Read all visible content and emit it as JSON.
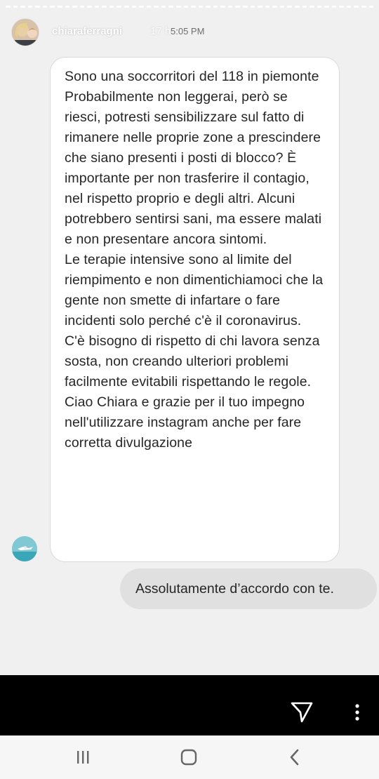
{
  "story": {
    "username": "chiaraferragni",
    "elapsed": "17 h",
    "clock": "5:05 PM"
  },
  "message": {
    "paragraphs": [
      "Sono una soccorritori del 118 in piemonte",
      "Probabilmente non leggerai, però se riesci, potresti sensibilizzare sul fatto di rimanere nelle proprie zone a prescindere che siano presenti i posti di blocco? È importante per non trasferire il contagio, nel rispetto proprio e degli altri. Alcuni potrebbero sentirsi sani, ma essere malati e non presentare ancora sintomi.",
      "Le terapie intensive sono al limite del riempimento e non dimentichiamoci che la gente non smette di infartare o fare incidenti solo perché c'è il coronavirus.",
      "C'è bisogno di rispetto di chi lavora senza sosta, non creando ulteriori problemi facilmente evitabili rispettando le regole.",
      "Ciao Chiara e grazie per il tuo impegno nell'utilizzare instagram anche per fare corretta divulgazione"
    ]
  },
  "reply": {
    "text": "Assolutamente d’accordo con te."
  },
  "icons": {
    "send": "send-icon",
    "more": "more-vertical-icon",
    "recents": "recent-apps-icon",
    "home": "home-icon",
    "back": "back-icon"
  },
  "colors": {
    "story_background": "#f0f0f0",
    "bubble": "#ffffff",
    "reply_bubble": "#e0e0e0",
    "text": "#262626"
  }
}
